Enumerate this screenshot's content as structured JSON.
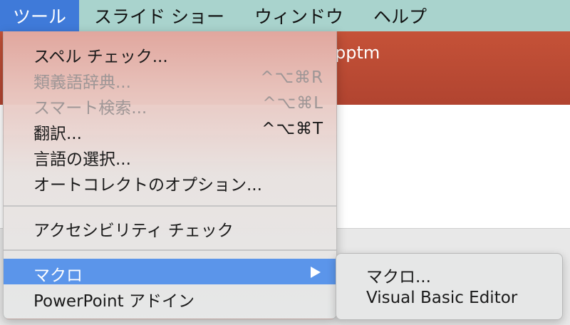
{
  "menubar": {
    "items": [
      {
        "label": "ツール",
        "active": true
      },
      {
        "label": "スライド ショー",
        "active": false
      },
      {
        "label": "ウィンドウ",
        "active": false
      },
      {
        "label": "ヘルプ",
        "active": false
      }
    ]
  },
  "window": {
    "title_fragment": "pptm"
  },
  "tools_menu": {
    "items": [
      {
        "label": "スペル チェック...",
        "shortcut": "",
        "enabled": true
      },
      {
        "label": "類義語辞典...",
        "shortcut": "^⌥⌘R",
        "enabled": false
      },
      {
        "label": "スマート検索...",
        "shortcut": "^⌥⌘L",
        "enabled": false
      },
      {
        "label": "翻訳...",
        "shortcut": "^⌥⌘T",
        "enabled": true
      },
      {
        "label": "言語の選択...",
        "shortcut": "",
        "enabled": true
      },
      {
        "label": "オートコレクトのオプション...",
        "shortcut": "",
        "enabled": true
      },
      {
        "label": "アクセシビリティ チェック",
        "shortcut": "",
        "enabled": true
      },
      {
        "label": "マクロ",
        "shortcut": "",
        "enabled": true,
        "highlighted": true,
        "submenu": true
      },
      {
        "label": "PowerPoint アドイン",
        "shortcut": "",
        "enabled": true
      }
    ]
  },
  "macro_submenu": {
    "items": [
      {
        "label": "マクロ..."
      },
      {
        "label": "Visual Basic Editor"
      }
    ]
  },
  "colors": {
    "menubar_bg": "#a9d3cd",
    "menubar_active": "#3f7ad9",
    "highlight": "#5b95ea",
    "window_title_bg": "#b14430",
    "disabled_text": "#9e9696"
  }
}
